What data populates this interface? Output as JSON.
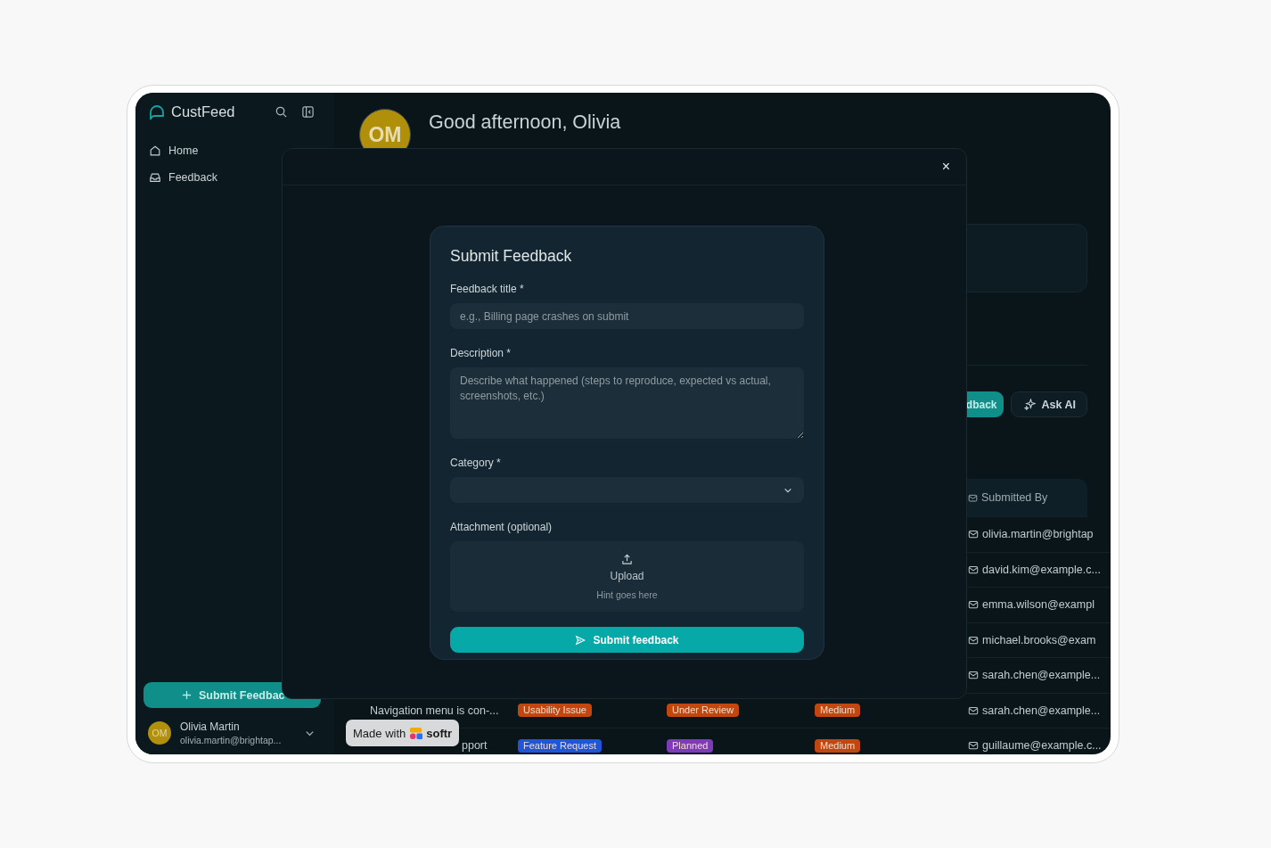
{
  "app": {
    "name": "CustFeed"
  },
  "sidebar": {
    "nav": [
      {
        "label": "Home",
        "selected": false
      },
      {
        "label": "Feedback",
        "selected": false
      }
    ],
    "submit_button": "Submit Feedbac",
    "user": {
      "initials": "OM",
      "name": "Olivia Martin",
      "email": "olivia.martin@brightap..."
    }
  },
  "header": {
    "initials": "OM",
    "greeting": "Good afternoon, Olivia"
  },
  "toolbar": [
    {
      "label": "dback",
      "kind": "primary"
    },
    {
      "label": "Ask AI",
      "kind": "ai"
    }
  ],
  "table": {
    "columns": [
      {
        "label": "Submitted By"
      }
    ],
    "rows": [
      {
        "email": "olivia.martin@brightap"
      },
      {
        "email": "david.kim@example.c..."
      },
      {
        "email": "emma.wilson@exampl"
      },
      {
        "email": "michael.brooks@exam"
      },
      {
        "email": "sarah.chen@example..."
      },
      {
        "title": "Navigation menu is con-...",
        "category": {
          "label": "Usability Issue",
          "color": "#c2470e"
        },
        "status": {
          "label": "Under Review",
          "color": "#c2470e"
        },
        "priority": {
          "label": "Medium",
          "color": "#c2470e"
        },
        "email": "sarah.chen@example..."
      },
      {
        "title": "pport",
        "category": {
          "label": "Feature Request",
          "color": "#1f55d6"
        },
        "status": {
          "label": "Planned",
          "color": "#7d3bb8"
        },
        "priority": {
          "label": "Medium",
          "color": "#c2470e"
        },
        "email": "guillaume@example.c..."
      }
    ]
  },
  "modal": {
    "close": "×",
    "title": "Submit Feedback",
    "fields": [
      {
        "kind": "text",
        "label": "Feedback title *",
        "placeholder": "e.g., Billing page crashes on submit"
      },
      {
        "kind": "textarea",
        "label": "Description *",
        "placeholder": "Describe what happened (steps to reproduce, expected vs actual, screenshots, etc.)"
      },
      {
        "kind": "select",
        "label": "Category *"
      },
      {
        "kind": "upload",
        "label": "Attachment (optional)",
        "button": "Upload",
        "hint": "Hint goes here"
      }
    ],
    "submit": "Submit feedback"
  },
  "badge": {
    "prefix": "Made with",
    "brand": "softr"
  }
}
